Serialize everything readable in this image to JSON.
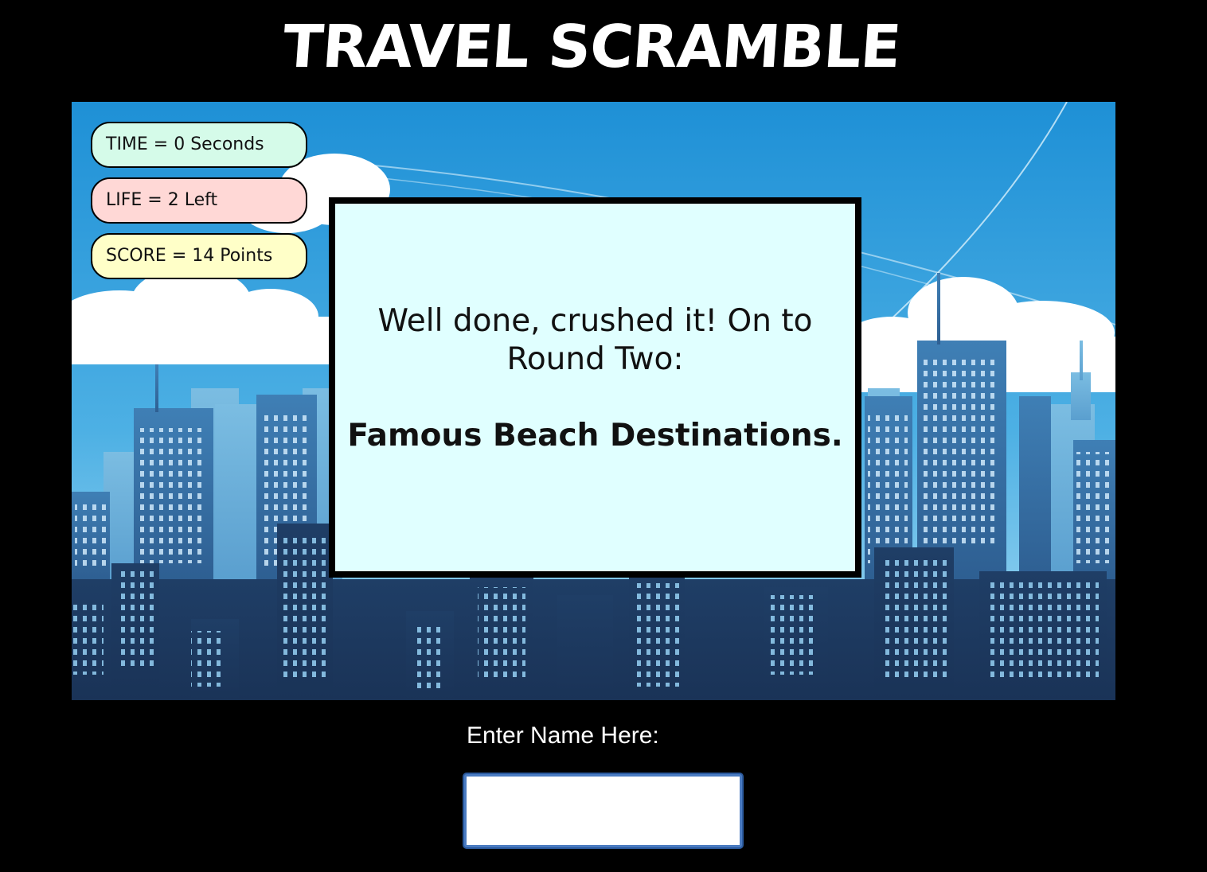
{
  "title": "TRAVEL SCRAMBLE",
  "stats": {
    "time": "TIME = 0 Seconds",
    "life": "LIFE = 2 Left",
    "score": "SCORE = 14 Points"
  },
  "modal": {
    "message": "Well done, crushed it! On to Round Two:",
    "category": "Famous Beach Destinations."
  },
  "name_entry": {
    "label": "Enter Name Here:",
    "value": ""
  },
  "colors": {
    "background": "#000000",
    "modal_bg": "#e0ffff",
    "time_badge": "#d5fbe9",
    "life_badge": "#ffd8d6",
    "score_badge": "#ffffc8",
    "sky_top": "#1e90d6",
    "sky_bottom": "#a9dcf4"
  }
}
